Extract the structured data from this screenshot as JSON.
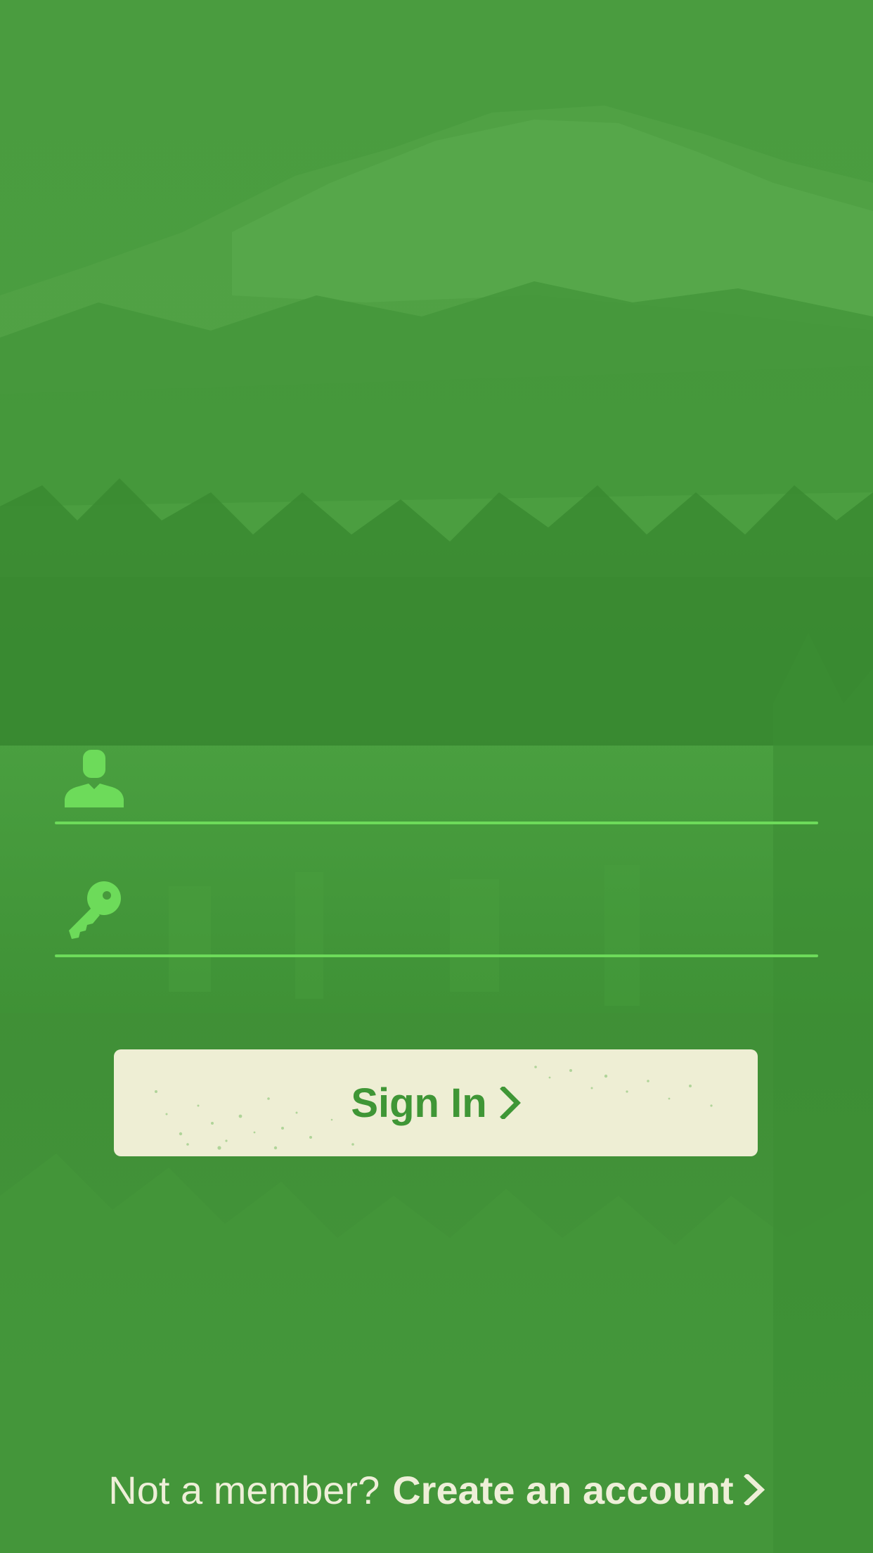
{
  "login": {
    "username": {
      "icon": "user-icon",
      "value": "",
      "placeholder": ""
    },
    "password": {
      "icon": "key-icon",
      "value": "",
      "placeholder": ""
    },
    "sign_in_label": "Sign In"
  },
  "footer": {
    "prompt": "Not a member?",
    "create_account_label": "Create an account"
  },
  "colors": {
    "background_green": "#479a3c",
    "field_underline": "#6ddb5a",
    "icon_green": "#6ddb5a",
    "button_fill": "#eeeed4",
    "button_text": "#3f9636",
    "footer_text": "#eeefd8"
  }
}
